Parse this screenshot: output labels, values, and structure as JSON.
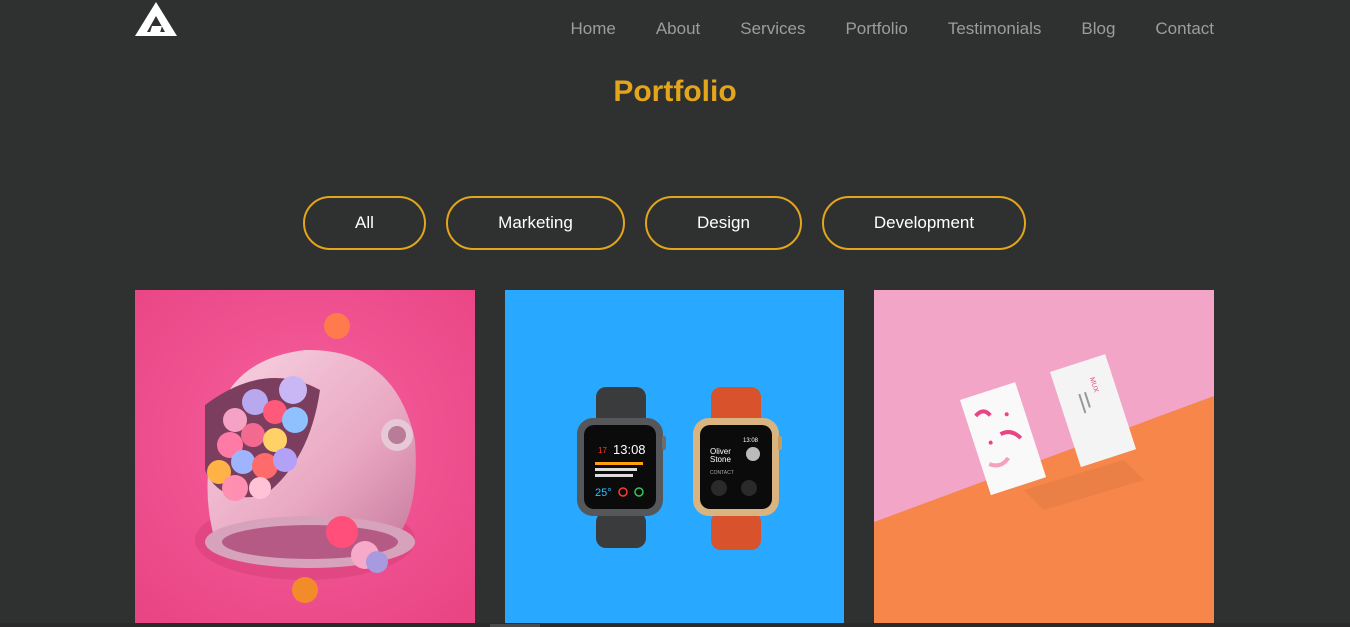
{
  "logo": {
    "icon": "triangle-logo-icon"
  },
  "nav": {
    "items": [
      "Home",
      "About",
      "Services",
      "Portfolio",
      "Testimonials",
      "Blog",
      "Contact"
    ],
    "color": "#9b9d9e"
  },
  "page_title": "Portfolio",
  "accent_color": "#e3a51c",
  "filters": [
    "All",
    "Marketing",
    "Design",
    "Development"
  ],
  "cards": [
    {
      "image": "astronaut-helmet-with-candy-balls",
      "background": "#ec4f91"
    },
    {
      "image": "two-smart-watches",
      "watch1_time": "13:08",
      "watch1_date": "17",
      "watch1_temp": "25°",
      "watch2_name_line1": "Oliver",
      "watch2_name_line2": "Stone",
      "watch2_time": "13:08",
      "watch2_label": "CONTACT",
      "background": "#28a8ff"
    },
    {
      "image": "business-cards-mockup",
      "card_brand": "MUX",
      "background": "#f3a5c7"
    }
  ]
}
